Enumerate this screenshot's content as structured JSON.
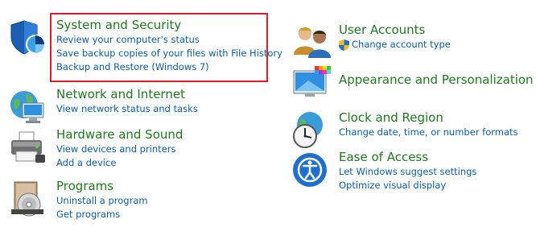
{
  "left": {
    "system_security": {
      "title": "System and Security",
      "links": [
        "Review your computer's status",
        "Save backup copies of your files with File History",
        "Backup and Restore (Windows 7)"
      ]
    },
    "network": {
      "title": "Network and Internet",
      "links": [
        "View network status and tasks"
      ]
    },
    "hardware": {
      "title": "Hardware and Sound",
      "links": [
        "View devices and printers",
        "Add a device"
      ]
    },
    "programs": {
      "title": "Programs",
      "links": [
        "Uninstall a program",
        "Get programs"
      ]
    }
  },
  "right": {
    "user_accounts": {
      "title": "User Accounts",
      "links": [
        "Change account type"
      ]
    },
    "appearance": {
      "title": "Appearance and Personalization",
      "links": []
    },
    "clock": {
      "title": "Clock and Region",
      "links": [
        "Change date, time, or number formats"
      ]
    },
    "ease": {
      "title": "Ease of Access",
      "links": [
        "Let Windows suggest settings",
        "Optimize visual display"
      ]
    }
  },
  "colors": {
    "title_green": "#1e7a1e",
    "link_blue": "#0b5eab",
    "highlight_red": "#e01a2b"
  }
}
